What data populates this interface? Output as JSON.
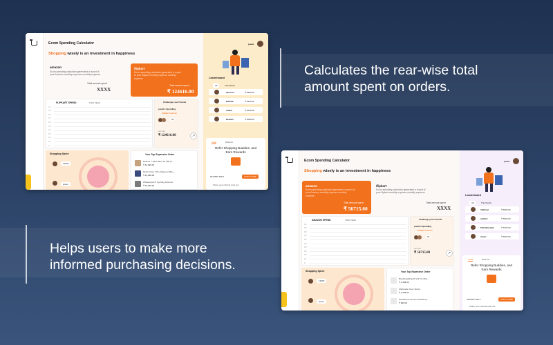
{
  "captions": {
    "top": "Calculates the rear-wise total amount spent on orders.",
    "bottom": "Helps users to make more informed purchasing decisions."
  },
  "shot_a": {
    "app_title": "Ecom Spending Calculator",
    "tagline_highlight": "Shopping",
    "tagline_rest": "wisely is an investment in happiness",
    "user_name": "preeti",
    "card1": {
      "brand": "amazon",
      "desc": "Ecom spending calculator generated a report of your Amazon monthly expense monthly expense",
      "total_label": "Total amount spent",
      "total_value": "XXXX"
    },
    "card2": {
      "brand": "flipkart",
      "desc": "Ecom spending calculator generated a report of your flipkart monthly expense monthly expense",
      "total_label": "Total amount spent",
      "total_value": "₹ 124616.00"
    },
    "chart": {
      "title": "FLIPKART SPEND",
      "period": "THIS YEAR",
      "yticks": [
        "1.0",
        "0.9",
        "0.8",
        "0.7",
        "0.6",
        "0.5",
        "0.4",
        "0.3",
        "0.2",
        "0.1",
        "0"
      ]
    },
    "challenge": {
      "title": "Challenge your Friends",
      "heading": "preeti's Spending",
      "sub": "GREEN Fashion",
      "badge": "04",
      "amount_label": "amount",
      "amount": "₹ 124616.00",
      "arrow": "↗"
    },
    "leaderboard": {
      "title": "Leaderboard",
      "tab_all": "All",
      "tab_friends": "This Month",
      "rows": [
        {
          "name": "apoorva",
          "amount": "₹ 4960.00"
        },
        {
          "name": "RADAS",
          "amount": "₹ 4940.00"
        },
        {
          "name": "shakti",
          "amount": "₹ 4220.00"
        },
        {
          "name": "Neelam",
          "amount": "₹ 4080.00"
        }
      ]
    },
    "referral": {
      "tab_invite": "Invite",
      "tab_referral": "Referral",
      "title": "Refer Shopping Buddies, and Earn Rewards",
      "code": "9127987-468-1",
      "button": "COPY CODE",
      "share": "Share your referral code via"
    },
    "spree": {
      "title": "Shopping Spree",
      "bubble1": "12000",
      "bubble2": "preeti"
    },
    "orders": {
      "title": "Your Top Expensive Order",
      "items": [
        {
          "name": "Realme 7 (Mist Blue, 64 GB) (4...",
          "price": "₹ 14,999.00"
        },
        {
          "name": "Redmi Note 7 Pro (Neptune Blue...",
          "price": "₹ 13,999.00"
        },
        {
          "name": "Wheelpiya 5.5 Kg Fully Automat...",
          "price": "₹ 12,000.00"
        }
      ]
    }
  },
  "shot_b": {
    "app_title": "Ecom Spending Calculator",
    "tagline_highlight": "Shopping",
    "tagline_rest": "wisely is an investment in happiness",
    "user_name": "preeti",
    "card1": {
      "brand": "amazon",
      "desc": "Ecom spending calculator generated a report of your Amazon monthly expense monthly expense",
      "total_label": "Total amount spent",
      "total_value": "₹ 56715.00"
    },
    "card2": {
      "brand": "flipkart",
      "desc": "Ecom spending calculator generated a report of your flipkart monthly expense monthly expense",
      "total_label": "Total amount spent",
      "total_value": "XXXX"
    },
    "chart": {
      "title": "AMAZON SPEND",
      "period": "THIS YEAR",
      "yticks": [
        "1.0",
        "0.9",
        "0.8",
        "0.7",
        "0.6",
        "0.5",
        "0.4",
        "0.3",
        "0.2",
        "0.1",
        "0"
      ]
    },
    "challenge": {
      "title": "Challenge your Friends",
      "heading": "preeti's Spending",
      "sub": "GREEN Fashion",
      "badge": "04",
      "amount_label": "amount",
      "amount": "₹ 56715.00",
      "arrow": "↗"
    },
    "leaderboard": {
      "title": "Leaderboard",
      "tab_all": "All",
      "tab_friends": "This Month",
      "rows": [
        {
          "name": "Vaibhavi",
          "amount": "₹ 6690.00"
        },
        {
          "name": "walbert",
          "amount": "₹ 6500.00"
        },
        {
          "name": "Palwalkaratan",
          "amount": "₹ 6200.00"
        },
        {
          "name": "Aryan",
          "amount": "₹ 6000.00"
        }
      ]
    },
    "referral": {
      "tab_invite": "Invite",
      "tab_referral": "Referral",
      "title": "Refer Shopping Buddies, and Earn Rewards",
      "code": "9127987-468-1",
      "button": "COPY CODE",
      "share": "Share your referral code via"
    },
    "spree": {
      "title": "Shopping Spree",
      "bubble1": "12000",
      "bubble2": "preeti"
    },
    "orders": {
      "title": "Your Top Expensive Order",
      "items": [
        {
          "name": "BanAbodeBrandT-shirt for Men...",
          "price": "₹ 1,499.00"
        },
        {
          "name": "Wellmade (Grey Stool)...",
          "price": "₹ 1,299.00"
        },
        {
          "name": "Woodbrook women drawstring...",
          "price": "₹ 999.00"
        }
      ]
    }
  }
}
